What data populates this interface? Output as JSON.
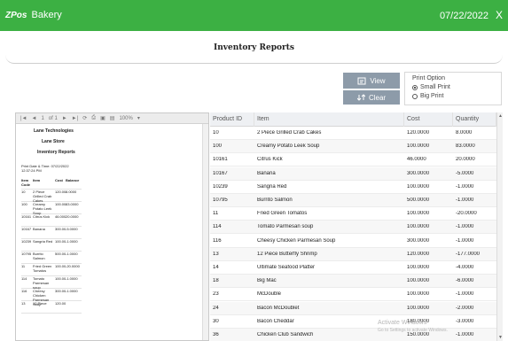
{
  "app": {
    "brand_mark": "Z",
    "brand_mark2": "Pos",
    "brand_name": "Bakery",
    "date": "07/22/2022",
    "close_glyph": "X"
  },
  "report": {
    "title": "Inventory Reports"
  },
  "buttons": {
    "view": "View",
    "clear": "Clear"
  },
  "print_option": {
    "legend": "Print Option",
    "small": "Small Print",
    "big": "Big Print",
    "selected": "small"
  },
  "viewer": {
    "toolbar": {
      "page": "1",
      "of": "of 1",
      "zoom": "100%"
    },
    "company": "Lane Technologies",
    "store": "Lane Store",
    "title": "Inventory Reports",
    "print_date": "Print Date & Time: 07/22/2022",
    "print_time": "12:37:24 PM",
    "columns": [
      "Item Code",
      "Item",
      "Cost",
      "Balance"
    ],
    "rows": [
      [
        "10",
        "2 Piece Grilled Crab Cakes",
        "120.00",
        "8.0000"
      ],
      [
        "100",
        "Creamy Potato Leek Soup",
        "100.00",
        "83.0000"
      ],
      [
        "10161",
        "Citrus Kick",
        "46.000",
        "20.0000"
      ],
      [
        "10167",
        "Banana",
        "300.00",
        "-5.0000"
      ],
      [
        "10239",
        "Sangria Red",
        "100.00",
        "-1.0000"
      ],
      [
        "10795",
        "Burrito Salmon",
        "500.00",
        "-1.0000"
      ],
      [
        "11",
        "Fried Green Tomatos",
        "100.00",
        "-20.0000"
      ],
      [
        "114",
        "Tomato Parmesan soup",
        "100.00",
        "-1.0000"
      ],
      [
        "116",
        "Cheesy Chicken Parmesan Soup",
        "300.00",
        "-1.0000"
      ],
      [
        "13",
        "12 Piece",
        "120.00",
        ""
      ]
    ]
  },
  "grid": {
    "columns": [
      "Product ID",
      "Item",
      "Cost",
      "Quantity"
    ],
    "rows": [
      {
        "id": "10",
        "item": "2 Piece Grilled Crab Cakes",
        "cost": "120.0000",
        "qty": "8.0000"
      },
      {
        "id": "100",
        "item": "Creamy Potato Leek Soup",
        "cost": "100.0000",
        "qty": "83.0000"
      },
      {
        "id": "10161",
        "item": "Citrus Kick",
        "cost": "46.0000",
        "qty": "20.0000"
      },
      {
        "id": "10167",
        "item": "Banana",
        "cost": "300.0000",
        "qty": "-5.0000"
      },
      {
        "id": "10239",
        "item": "Sangria Red",
        "cost": "100.0000",
        "qty": "-1.0000"
      },
      {
        "id": "10795",
        "item": "Burrito Salmon",
        "cost": "500.0000",
        "qty": "-1.0000"
      },
      {
        "id": "11",
        "item": "Fried Green Tomatos",
        "cost": "100.0000",
        "qty": "-20.0000"
      },
      {
        "id": "114",
        "item": "Tomato Parmesan soup",
        "cost": "100.0000",
        "qty": "-1.0000"
      },
      {
        "id": "116",
        "item": "Cheesy Chicken Parmesan Soup",
        "cost": "300.0000",
        "qty": "-1.0000"
      },
      {
        "id": "13",
        "item": "12 Piece Butterfly Shrimp",
        "cost": "120.0000",
        "qty": "-177.0000"
      },
      {
        "id": "14",
        "item": "Ultimate Seafood Platter",
        "cost": "100.0000",
        "qty": "-4.0000"
      },
      {
        "id": "18",
        "item": "Big Mac",
        "cost": "100.0000",
        "qty": "-6.0000"
      },
      {
        "id": "23",
        "item": "McDouble",
        "cost": "100.0000",
        "qty": "-1.0000"
      },
      {
        "id": "24",
        "item": "Bacon McDoublet",
        "cost": "100.0000",
        "qty": "-2.0000"
      },
      {
        "id": "30",
        "item": "Bacon Cheddar",
        "cost": "180.0000",
        "qty": "-3.0000"
      },
      {
        "id": "36",
        "item": "Chicken Club Sandwich",
        "cost": "150.0000",
        "qty": "-1.0000"
      }
    ]
  },
  "watermark": {
    "line1": "Activate Windows",
    "line2": "Go to Settings to activate Windows."
  },
  "colors": {
    "titlebar": "#3cb043",
    "button": "#8d9ba9"
  }
}
